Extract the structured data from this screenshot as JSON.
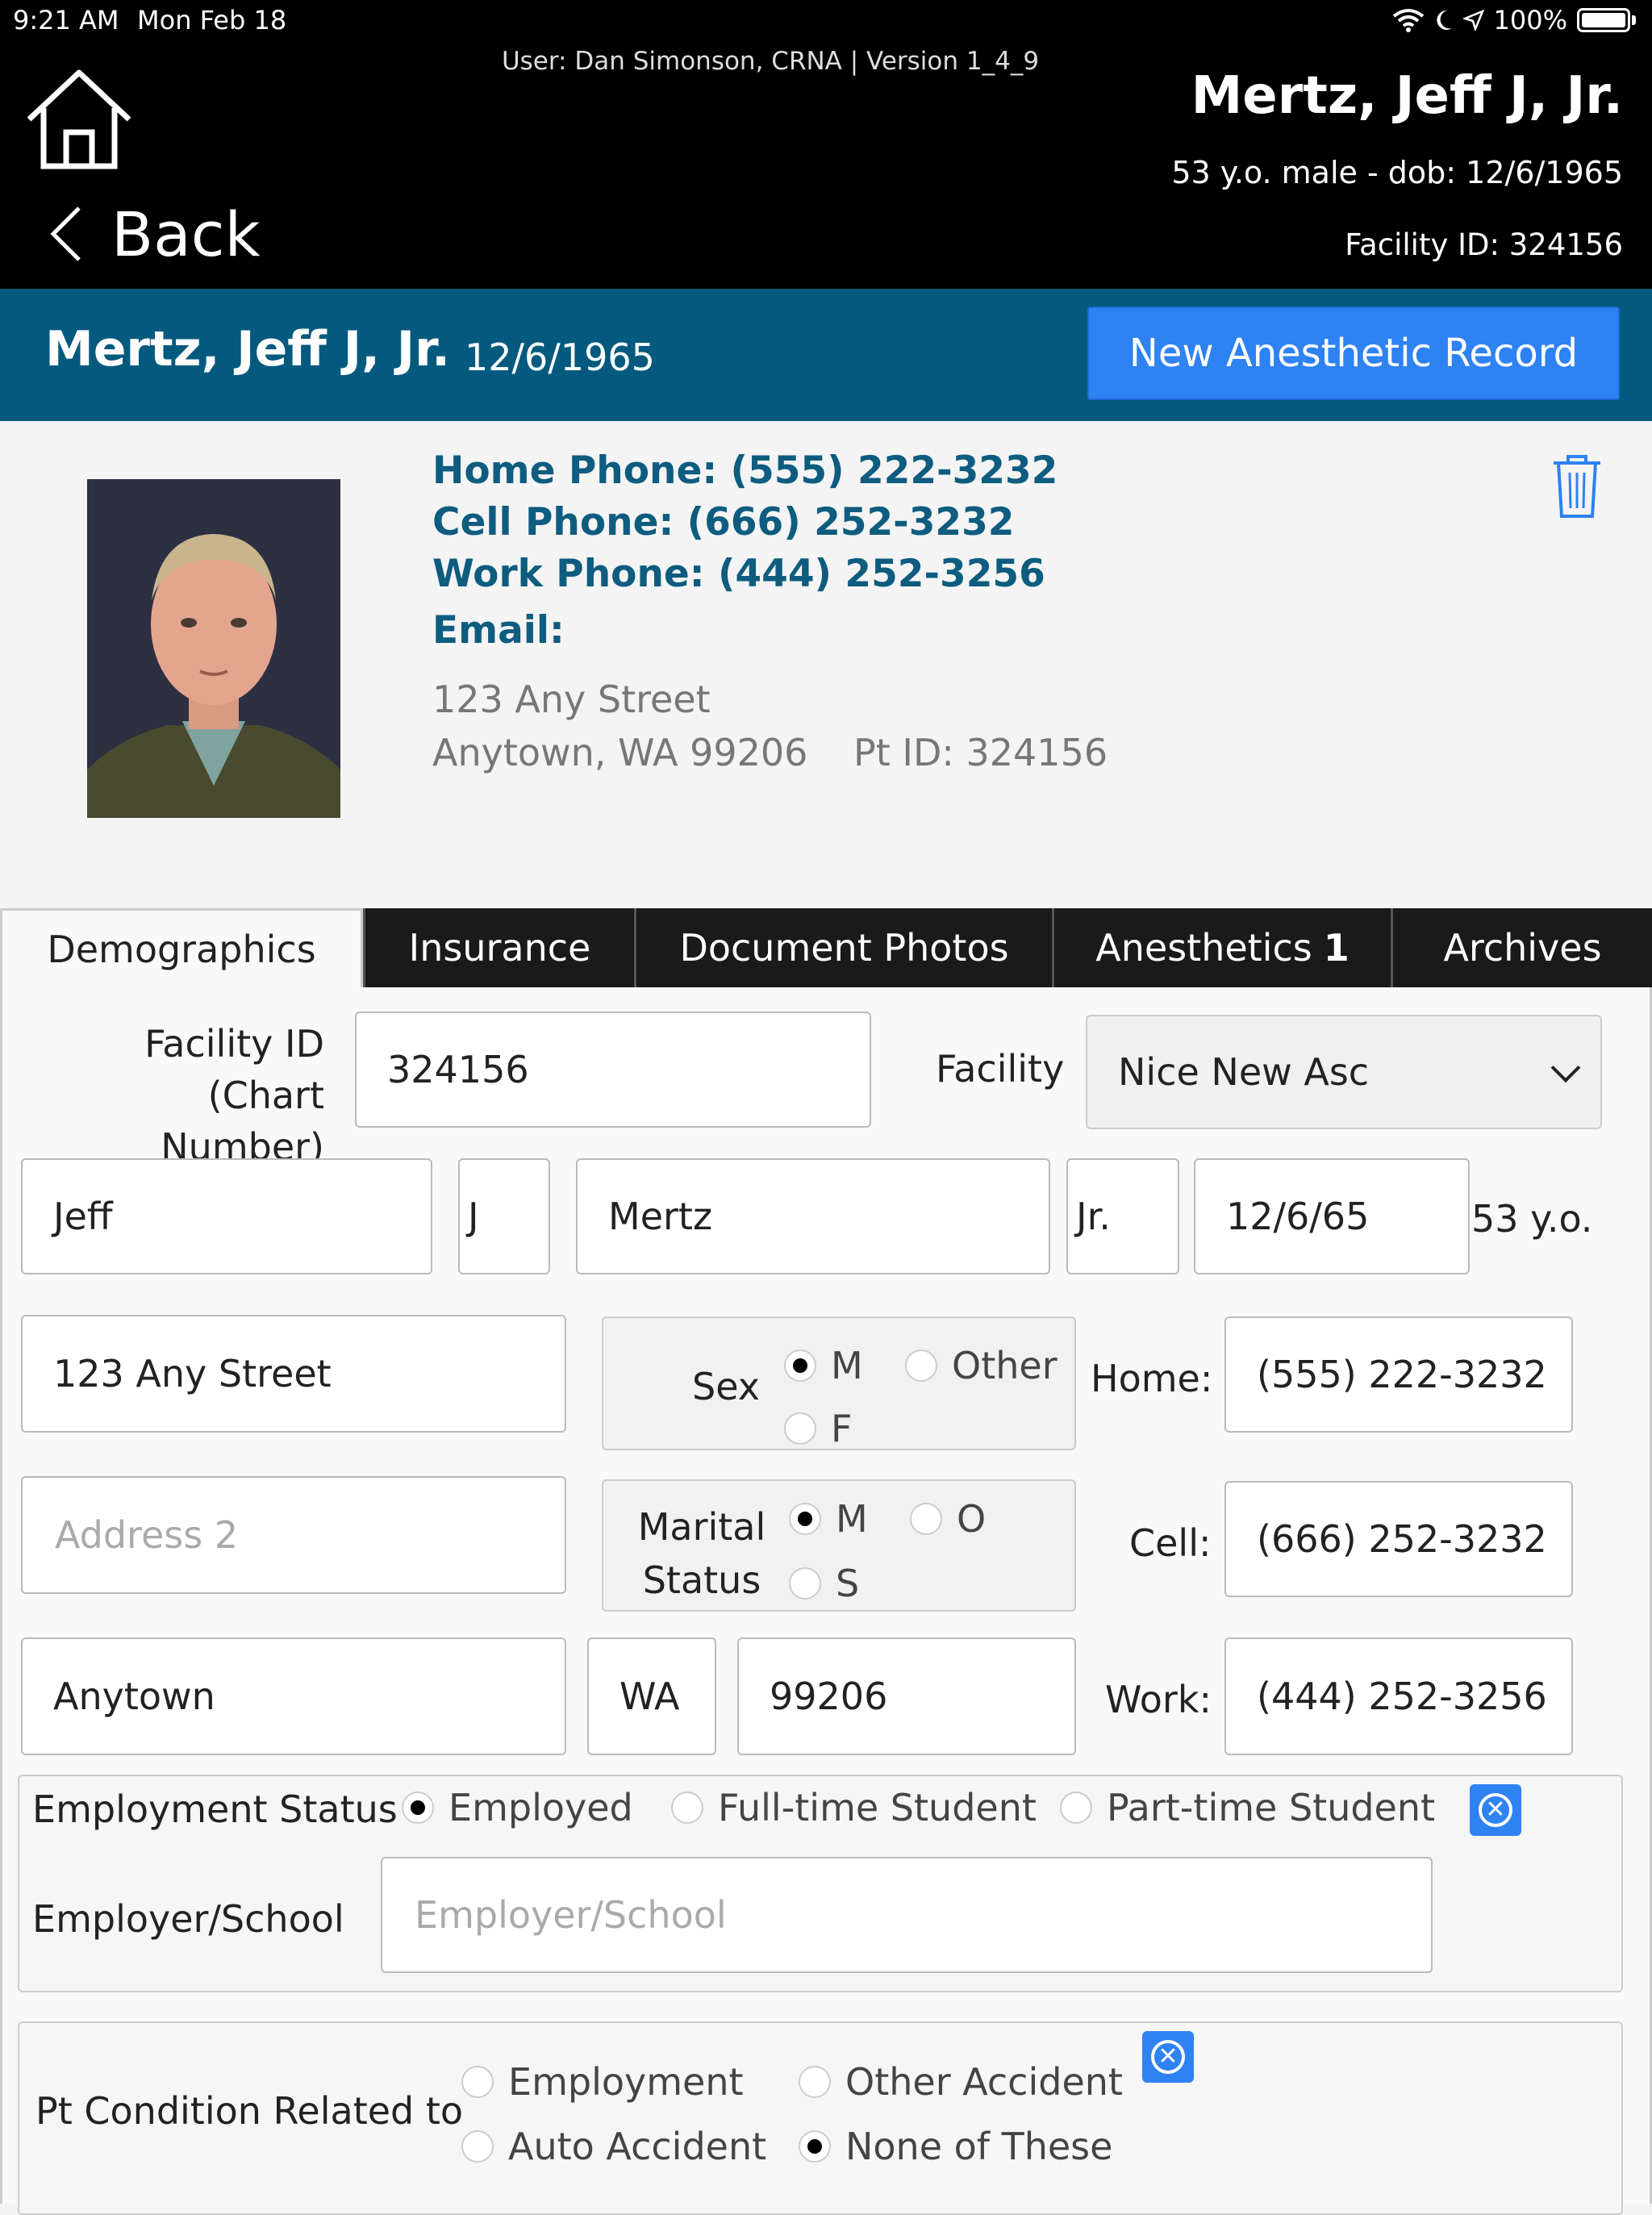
{
  "status_bar": {
    "time": "9:21 AM",
    "date": "Mon Feb 18",
    "battery": "100%"
  },
  "header": {
    "user_version": "User: Dan Simonson, CRNA |  Version 1_4_9",
    "back_label": "Back",
    "patient_name": "Mertz, Jeff J, Jr.",
    "age_sex_dob": "53 y.o. male - dob: 12/6/1965",
    "facility_id": "Facility ID: 324156"
  },
  "patient_bar": {
    "name": "Mertz, Jeff J, Jr.",
    "dob": "12/6/1965",
    "new_record_label": "New Anesthetic Record",
    "accent": "#045a7e",
    "button_color": "#2e82f2"
  },
  "contact": {
    "home_phone": "Home Phone: (555) 222-3232",
    "cell_phone": "Cell Phone: (666) 252-3232",
    "work_phone": "Work Phone: (444) 252-3256",
    "email": "Email:",
    "address1": "123 Any Street",
    "address2": "Anytown, WA 99206",
    "pt_id": "Pt ID: 324156"
  },
  "tabs": [
    {
      "label": "Demographics"
    },
    {
      "label": "Insurance"
    },
    {
      "label": "Document Photos"
    },
    {
      "label": "Anesthetics",
      "badge": "1"
    },
    {
      "label": "Archives"
    }
  ],
  "form": {
    "facility_id_label_1": "Facility ID",
    "facility_id_label_2": "(Chart Number)",
    "facility_id_value": "324156",
    "facility_label": "Facility",
    "facility_value": "Nice New Asc",
    "first_name": "Jeff",
    "middle_initial": "J",
    "last_name": "Mertz",
    "suffix": "Jr.",
    "dob": "12/6/65",
    "age": "53 y.o.",
    "address1": "123 Any Street",
    "address2_placeholder": "Address 2",
    "city": "Anytown",
    "state": "WA",
    "zip": "99206",
    "sex_label": "Sex",
    "sex_options": [
      "M",
      "Other",
      "F"
    ],
    "marital_label_1": "Marital",
    "marital_label_2": "Status",
    "marital_options": [
      "M",
      "O",
      "S"
    ],
    "home_label": "Home:",
    "home_phone": "(555) 222-3232",
    "cell_label": "Cell:",
    "cell_phone": "(666) 252-3232",
    "work_label": "Work:",
    "work_phone": "(444) 252-3256",
    "employment_status_label": "Employment Status",
    "employment_options": [
      "Employed",
      "Full-time Student",
      "Part-time Student"
    ],
    "employer_label": "Employer/School",
    "employer_placeholder": "Employer/School",
    "condition_label": "Pt Condition Related to",
    "condition_options": [
      "Employment",
      "Other Accident",
      "Auto Accident",
      "None of These"
    ]
  }
}
